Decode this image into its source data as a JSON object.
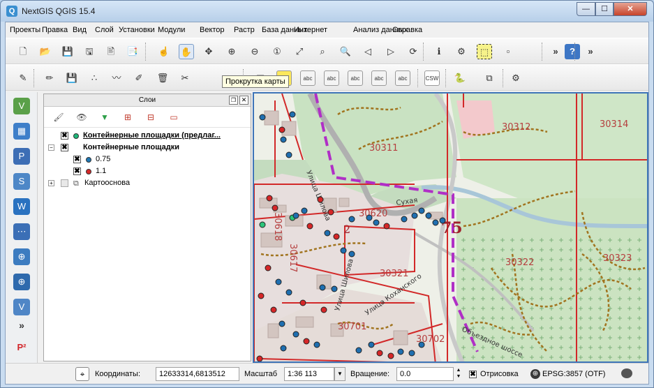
{
  "window": {
    "title": "NextGIS QGIS 15.4",
    "app_icon": "qgis-logo-icon",
    "controls": {
      "minimize": "—",
      "maximize": "☐",
      "close": "✕"
    }
  },
  "menubar": {
    "items": [
      "Проекты",
      "Правка",
      "Вид",
      "Слой",
      "Установки",
      "Модули",
      "Вектор",
      "Растр",
      "База данных",
      "Интернет",
      "Анализ данных",
      "Справка"
    ]
  },
  "toolbar1": {
    "icons": [
      "new-project-icon",
      "open-folder-icon",
      "save-icon",
      "save-as-icon",
      "new-print-layout-icon",
      "layout-manager-icon",
      "touch-icon",
      "pan-icon",
      "pan-to-selection-icon",
      "zoom-in-icon",
      "zoom-out-icon",
      "zoom-native-icon",
      "zoom-full-icon",
      "zoom-to-selection-icon",
      "zoom-to-layer-icon",
      "zoom-last-icon",
      "zoom-next-icon",
      "refresh-icon",
      "identify-icon",
      "measure-icon",
      "select-icon",
      "deselect-icon",
      "more-icon",
      "help-icon",
      "more-icon"
    ],
    "overflow": "»"
  },
  "toolbar2": {
    "icons": [
      "digitize-icon",
      "edit-pencil-icon",
      "save-edits-icon",
      "add-point-icon",
      "add-line-icon",
      "node-tool-icon",
      "delete-icon",
      "cut-icon",
      "label-icon",
      "label-a-icon",
      "label-pin-icon",
      "label-show-icon",
      "label-move-icon",
      "label-rotate-icon",
      "label-change-icon",
      "csw-icon",
      "python-icon",
      "metasearch-icon",
      "plugin-icon"
    ],
    "csw_text": "CSW",
    "abc_text": "abc"
  },
  "tooltip": {
    "text": "Прокрутка карты"
  },
  "left_tools": {
    "icons": [
      "add-vector-layer-icon",
      "add-raster-layer-icon",
      "add-postgis-icon",
      "add-spatialite-icon",
      "add-wms-icon",
      "add-delimited-icon",
      "add-wfs-icon",
      "add-wcs-icon",
      "add-virtual-icon",
      "expand-icon",
      "p2-icon"
    ],
    "expand_glyph": "»",
    "p2_text": "P²"
  },
  "layers_panel": {
    "title": "Слои",
    "tool_icons": [
      "open-styling-icon",
      "visibility-icon",
      "filter-icon",
      "expand-all-icon",
      "collapse-all-icon",
      "remove-layer-icon"
    ],
    "layers": [
      {
        "name": "Контейнерные площадки (предлаг...",
        "checked": true,
        "dot": "#1eb87a",
        "bold": true,
        "underline": true
      },
      {
        "name": "Контейнерные площадки",
        "checked": true,
        "group": true,
        "bold": true
      },
      {
        "name": "0.75",
        "checked": true,
        "dot": "#1f77b4"
      },
      {
        "name": "1.1",
        "checked": true,
        "dot": "#d62728"
      },
      {
        "name": "Картооснова",
        "checked": false,
        "group": true
      }
    ]
  },
  "map": {
    "district_labels": [
      "30312",
      "30314",
      "30311",
      "30620",
      "30321",
      "30322",
      "30323",
      "30701",
      "30702",
      "30618",
      "30617"
    ],
    "street_labels": [
      "Улица Шилова",
      "Улица Коханского",
      "Объездное шоссе",
      "Сухая",
      "Улица Шилова"
    ],
    "marker_label": "75",
    "marker_label_2": "2"
  },
  "statusbar": {
    "coords_label": "Координаты:",
    "coords_value": "12633314,6813512",
    "scale_label": "Масштаб",
    "scale_value": "1:36 113",
    "rotation_label": "Вращение:",
    "rotation_value": "0.0",
    "render_label": "Отрисовка",
    "render_checked": true,
    "crs": "EPSG:3857 (OTF)",
    "icons": [
      "mouse-coords-icon",
      "render-checkbox-icon",
      "crs-globe-icon",
      "messages-icon"
    ]
  }
}
